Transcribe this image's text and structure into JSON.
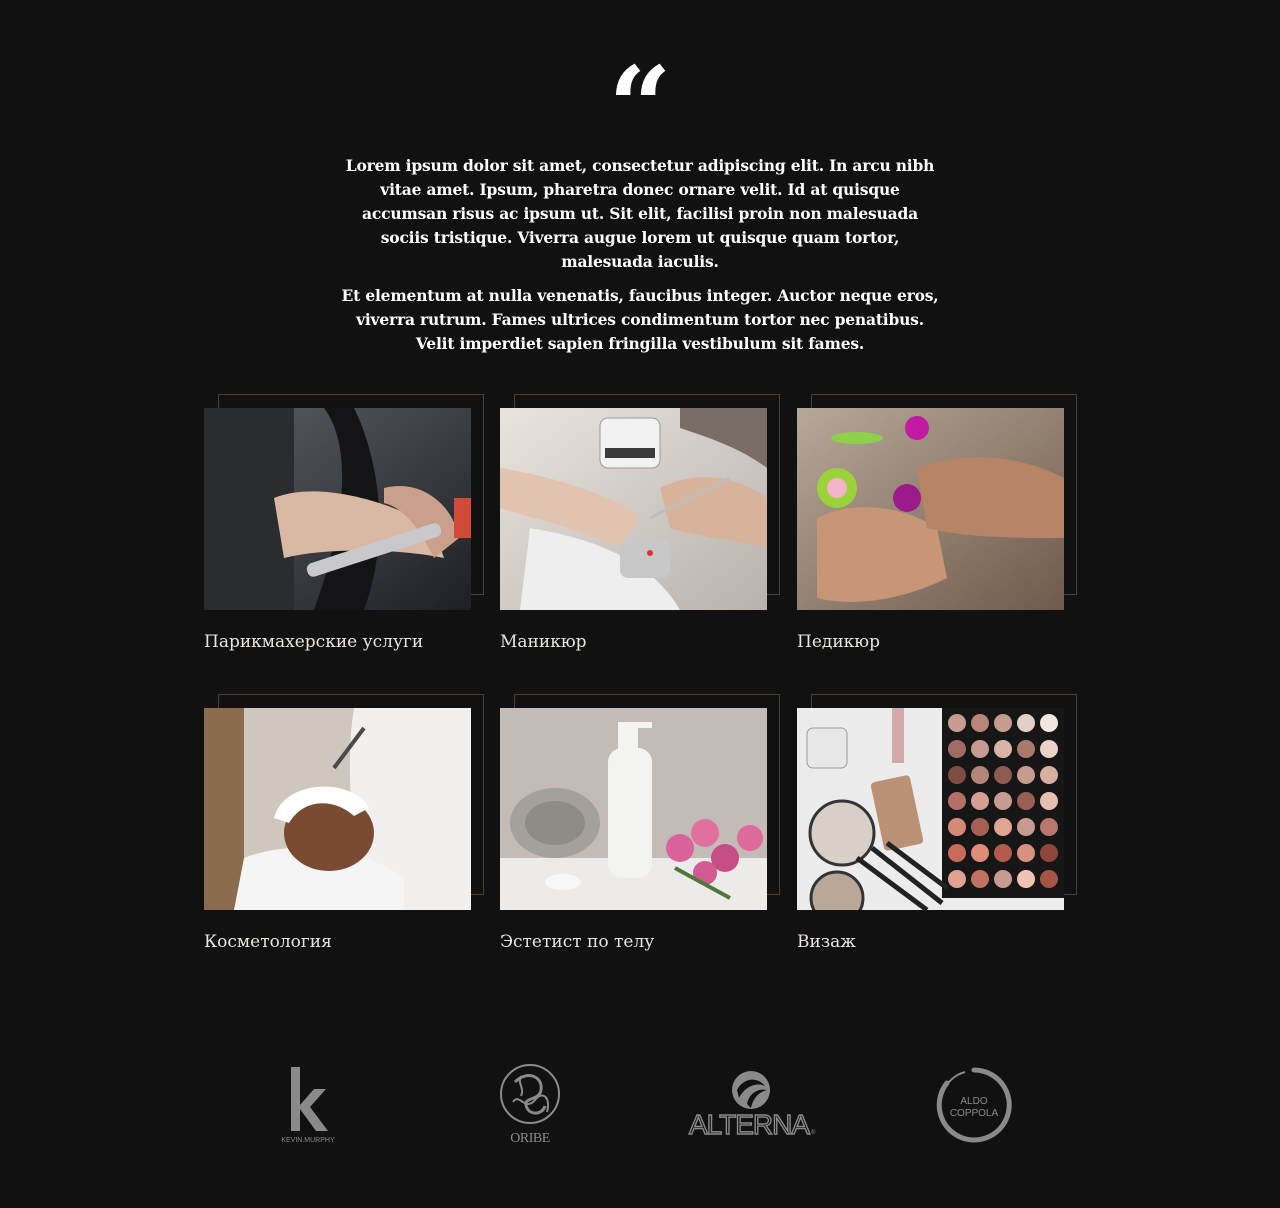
{
  "quote": {
    "paragraphs": [
      "Lorem ipsum dolor sit amet, consectetur adipiscing elit. In arcu nibh vitae amet. Ipsum, pharetra donec ornare velit. Id at quisque accumsan risus ac ipsum ut. Sit elit, facilisi proin non malesuada sociis tristique. Viverra augue lorem ut quisque quam tortor, malesuada iaculis.",
      "Et elementum at nulla venenatis, faucibus integer. Auctor neque eros, viverra rutrum. Fames ultrices condimentum tortor nec penatibus. Velit imperdiet sapien fringilla vestibulum sit fames."
    ]
  },
  "services": [
    {
      "label": "Парикмахерские услуги"
    },
    {
      "label": "Маникюр"
    },
    {
      "label": "Педикюр"
    },
    {
      "label": "Косметология"
    },
    {
      "label": "Эстетист по телу"
    },
    {
      "label": "Визаж"
    }
  ],
  "brands": [
    {
      "name": "KEVIN.MURPHY",
      "icon": "kevin-murphy-logo"
    },
    {
      "name": "ORIBE",
      "icon": "oribe-logo"
    },
    {
      "name": "ALTERNA",
      "icon": "alterna-logo"
    },
    {
      "name": "ALDO COPPOLA",
      "icon": "aldo-coppola-logo"
    }
  ],
  "colors": {
    "background": "#111111",
    "text": "#ffffff",
    "frame": "#4a4033",
    "logo": "#8a8a8a"
  }
}
